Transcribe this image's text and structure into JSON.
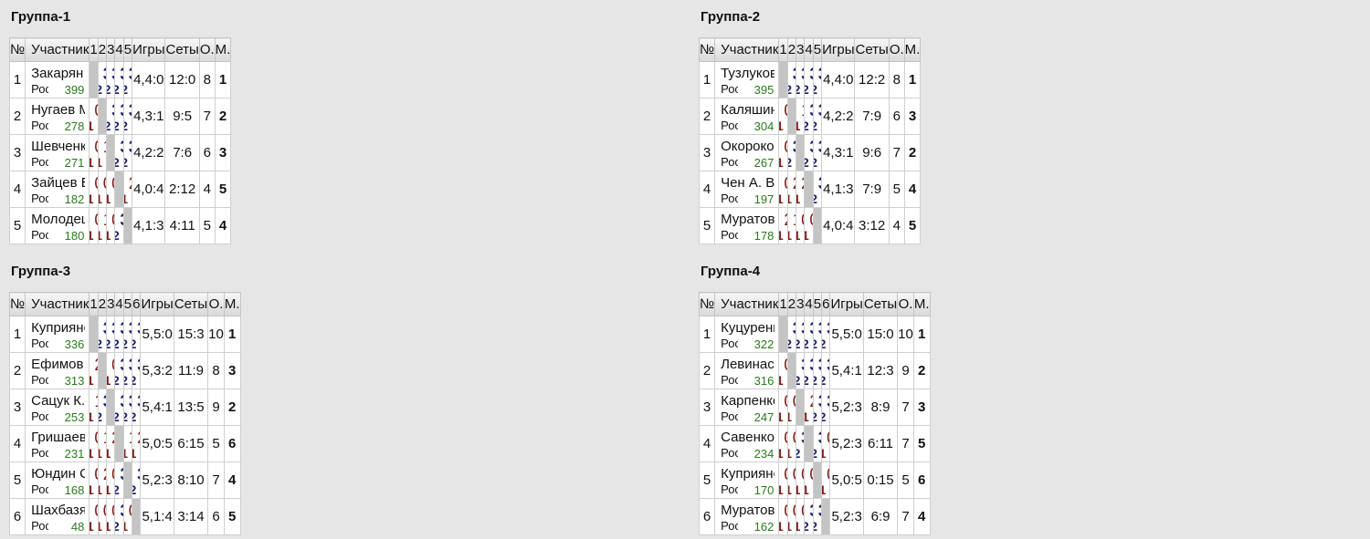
{
  "groups": [
    {
      "title": "Группа-1",
      "headers": {
        "num": "№",
        "name": "Участник",
        "games": "Игры",
        "sets": "Сеты",
        "points": "О.",
        "place": "М.",
        "cols": [
          "1",
          "2",
          "3",
          "4",
          "5"
        ]
      },
      "rows": [
        {
          "num": "1",
          "name": "Закарян Н. А.",
          "region": "Ростовская обл., Рост…",
          "rating": "399",
          "cells": [
            null,
            {
              "s": "3:0",
              "p": "2",
              "w": true
            },
            {
              "s": "3:0",
              "p": "2",
              "w": true
            },
            {
              "s": "3:0",
              "p": "2",
              "w": true
            },
            {
              "s": "3:0",
              "p": "2",
              "w": true
            }
          ],
          "games": "4,4:0",
          "sets": "12:0",
          "points": "8",
          "place": "1"
        },
        {
          "num": "2",
          "name": "Нугаев М. И.",
          "region": "Ростовская обл., Рост…",
          "rating": "278",
          "cells": [
            {
              "s": "0:3",
              "p": "1",
              "w": false
            },
            null,
            {
              "s": "3:1",
              "p": "2",
              "w": true
            },
            {
              "s": "3:0",
              "p": "2",
              "w": true
            },
            {
              "s": "3:1",
              "p": "2",
              "w": true
            }
          ],
          "games": "4,3:1",
          "sets": "9:5",
          "points": "7",
          "place": "2"
        },
        {
          "num": "3",
          "name": "Шевченко Е. И.",
          "region": "Ростовская обл., Рост…",
          "rating": "271",
          "cells": [
            {
              "s": "0:3",
              "p": "1",
              "w": false
            },
            {
              "s": "1:3",
              "p": "1",
              "w": false
            },
            null,
            {
              "s": "3:0",
              "p": "2",
              "w": true
            },
            {
              "s": "3:0",
              "p": "2",
              "w": true
            }
          ],
          "games": "4,2:2",
          "sets": "7:6",
          "points": "6",
          "place": "3"
        },
        {
          "num": "4",
          "name": "Зайцев Е. С.",
          "region": "Ростовская обл., Рост…",
          "rating": "182",
          "cells": [
            {
              "s": "0:3",
              "p": "1",
              "w": false
            },
            {
              "s": "0:3",
              "p": "1",
              "w": false
            },
            {
              "s": "0:3",
              "p": "1",
              "w": false
            },
            null,
            {
              "s": "2:3",
              "p": "1",
              "w": false
            }
          ],
          "games": "4,0:4",
          "sets": "2:12",
          "points": "4",
          "place": "5"
        },
        {
          "num": "5",
          "name": "Молодецкий В. С.",
          "region": "Ростовская обл., Рост…",
          "rating": "180",
          "cells": [
            {
              "s": "0:3",
              "p": "1",
              "w": false
            },
            {
              "s": "1:3",
              "p": "1",
              "w": false
            },
            {
              "s": "0:3",
              "p": "1",
              "w": false
            },
            {
              "s": "3:2",
              "p": "2",
              "w": true
            },
            null
          ],
          "games": "4,1:3",
          "sets": "4:11",
          "points": "5",
          "place": "4"
        }
      ]
    },
    {
      "title": "Группа-2",
      "headers": {
        "num": "№",
        "name": "Участник",
        "games": "Игры",
        "sets": "Сеты",
        "points": "О.",
        "place": "М.",
        "cols": [
          "1",
          "2",
          "3",
          "4",
          "5"
        ]
      },
      "rows": [
        {
          "num": "1",
          "name": "Тузлуков А. Е.",
          "region": "Ростовская обл., Рост…",
          "rating": "395",
          "cells": [
            null,
            {
              "s": "3:0",
              "p": "2",
              "w": true
            },
            {
              "s": "3:0",
              "p": "2",
              "w": true
            },
            {
              "s": "3:0",
              "p": "2",
              "w": true
            },
            {
              "s": "3:2",
              "p": "2",
              "w": true
            }
          ],
          "games": "4,4:0",
          "sets": "12:2",
          "points": "8",
          "place": "1"
        },
        {
          "num": "2",
          "name": "Каляшин Д. А.",
          "region": "Ростовская область, …",
          "rating": "304",
          "cells": [
            {
              "s": "0:3",
              "p": "1",
              "w": false
            },
            null,
            {
              "s": "1:3",
              "p": "1",
              "w": false
            },
            {
              "s": "3:2",
              "p": "2",
              "w": true
            },
            {
              "s": "3:1",
              "p": "2",
              "w": true
            }
          ],
          "games": "4,2:2",
          "sets": "7:9",
          "points": "6",
          "place": "3"
        },
        {
          "num": "3",
          "name": "Окороков В. В.",
          "region": "Ростовская область, …",
          "rating": "267",
          "cells": [
            {
              "s": "0:3",
              "p": "1",
              "w": false
            },
            {
              "s": "3:1",
              "p": "2",
              "w": true
            },
            null,
            {
              "s": "3:2",
              "p": "2",
              "w": true
            },
            {
              "s": "3:0",
              "p": "2",
              "w": true
            }
          ],
          "games": "4,3:1",
          "sets": "9:6",
          "points": "7",
          "place": "2"
        },
        {
          "num": "4",
          "name": "Чен А. В.",
          "region": "Ростовская обл., Рост…",
          "rating": "197",
          "cells": [
            {
              "s": "0:3",
              "p": "1",
              "w": false
            },
            {
              "s": "2:3",
              "p": "1",
              "w": false
            },
            {
              "s": "2:3",
              "p": "1",
              "w": false
            },
            null,
            {
              "s": "3:0",
              "p": "2",
              "w": true
            }
          ],
          "games": "4,1:3",
          "sets": "7:9",
          "points": "5",
          "place": "4"
        },
        {
          "num": "5",
          "name": "Муратов-Милехин Л. П.",
          "region": "Ростовская обл., Рост…",
          "rating": "178",
          "cells": [
            {
              "s": "2:3",
              "p": "1",
              "w": false
            },
            {
              "s": "1:3",
              "p": "1",
              "w": false
            },
            {
              "s": "0:3",
              "p": "1",
              "w": false
            },
            {
              "s": "0:3",
              "p": "1",
              "w": false
            },
            null
          ],
          "games": "4,0:4",
          "sets": "3:12",
          "points": "4",
          "place": "5"
        }
      ]
    },
    {
      "title": "Группа-3",
      "headers": {
        "num": "№",
        "name": "Участник",
        "games": "Игры",
        "sets": "Сеты",
        "points": "О.",
        "place": "М.",
        "cols": [
          "1",
          "2",
          "3",
          "4",
          "5",
          "6"
        ]
      },
      "rows": [
        {
          "num": "1",
          "name": "Куприянов М. М.",
          "region": "Ростовская обл., Рост…",
          "rating": "336",
          "cells": [
            null,
            {
              "s": "3:2",
              "p": "2",
              "w": true
            },
            {
              "s": "3:1",
              "p": "2",
              "w": true
            },
            {
              "s": "3:0",
              "p": "2",
              "w": true
            },
            {
              "s": "3:0",
              "p": "2",
              "w": true
            },
            {
              "s": "3:0",
              "p": "2",
              "w": true
            }
          ],
          "games": "5,5:0",
          "sets": "15:3",
          "points": "10",
          "place": "1"
        },
        {
          "num": "2",
          "name": "Ефимов А. Д.",
          "region": "Ростовская область, …",
          "rating": "313",
          "cells": [
            {
              "s": "2:3",
              "p": "1",
              "w": false
            },
            null,
            {
              "s": "0:3",
              "p": "1",
              "w": false
            },
            {
              "s": "3:1",
              "p": "2",
              "w": true
            },
            {
              "s": "3:2",
              "p": "2",
              "w": true
            },
            {
              "s": "3:0",
              "p": "2",
              "w": true
            }
          ],
          "games": "5,3:2",
          "sets": "11:9",
          "points": "8",
          "place": "3"
        },
        {
          "num": "3",
          "name": "Сацук К. С.",
          "region": "Ростовская обл., Рост…",
          "rating": "253",
          "cells": [
            {
              "s": "1:3",
              "p": "1",
              "w": false
            },
            {
              "s": "3:0",
              "p": "2",
              "w": true
            },
            null,
            {
              "s": "3:2",
              "p": "2",
              "w": true
            },
            {
              "s": "3:0",
              "p": "2",
              "w": true
            },
            {
              "s": "3:0",
              "p": "2",
              "w": true
            }
          ],
          "games": "5,4:1",
          "sets": "13:5",
          "points": "9",
          "place": "2"
        },
        {
          "num": "4",
          "name": "Гришаев В. А.",
          "region": "Ростовская обл., Рост…",
          "rating": "231",
          "cells": [
            {
              "s": "0:3",
              "p": "1",
              "w": false
            },
            {
              "s": "1:3",
              "p": "1",
              "w": false
            },
            {
              "s": "2:3",
              "p": "1",
              "w": false
            },
            null,
            {
              "s": "1:3",
              "p": "1",
              "w": false
            },
            {
              "s": "2:3",
              "p": "1",
              "w": false
            }
          ],
          "games": "5,0:5",
          "sets": "6:15",
          "points": "5",
          "place": "6"
        },
        {
          "num": "5",
          "name": "Юндин С. В.",
          "region": "Ростовская обл., Рост…",
          "rating": "168",
          "cells": [
            {
              "s": "0:3",
              "p": "1",
              "w": false
            },
            {
              "s": "2:3",
              "p": "1",
              "w": false
            },
            {
              "s": "0:3",
              "p": "1",
              "w": false
            },
            {
              "s": "3:1",
              "p": "2",
              "w": true
            },
            null,
            {
              "s": "3:0",
              "p": "2",
              "w": true
            }
          ],
          "games": "5,2:3",
          "sets": "8:10",
          "points": "7",
          "place": "4"
        },
        {
          "num": "6",
          "name": "Шахбазян А. Г.",
          "region": "Ростовская обл., Рост…",
          "rating": "48",
          "cells": [
            {
              "s": "0:3",
              "p": "1",
              "w": false
            },
            {
              "s": "0:3",
              "p": "1",
              "w": false
            },
            {
              "s": "0:3",
              "p": "1",
              "w": false
            },
            {
              "s": "3:2",
              "p": "2",
              "w": true
            },
            {
              "s": "0:3",
              "p": "1",
              "w": false
            },
            null
          ],
          "games": "5,1:4",
          "sets": "3:14",
          "points": "6",
          "place": "5"
        }
      ]
    },
    {
      "title": "Группа-4",
      "headers": {
        "num": "№",
        "name": "Участник",
        "games": "Игры",
        "sets": "Сеты",
        "points": "О.",
        "place": "М.",
        "cols": [
          "1",
          "2",
          "3",
          "4",
          "5",
          "6"
        ]
      },
      "rows": [
        {
          "num": "1",
          "name": "Куцуренко М. А.",
          "region": "Ростовская обл., Рост…",
          "rating": "322",
          "cells": [
            null,
            {
              "s": "3:0",
              "p": "2",
              "w": true
            },
            {
              "s": "3:0",
              "p": "2",
              "w": true
            },
            {
              "s": "3:0",
              "p": "2",
              "w": true
            },
            {
              "s": "3:0",
              "p": "2",
              "w": true
            },
            {
              "s": "3:0",
              "p": "2",
              "w": true
            }
          ],
          "games": "5,5:0",
          "sets": "15:0",
          "points": "10",
          "place": "1"
        },
        {
          "num": "2",
          "name": "Левинас А. В.",
          "region": "Ростовская обл., Тага…",
          "rating": "316",
          "cells": [
            {
              "s": "0:3",
              "p": "1",
              "w": false
            },
            null,
            {
              "s": "3:0",
              "p": "2",
              "w": true
            },
            {
              "s": "3:0",
              "p": "2",
              "w": true
            },
            {
              "s": "3:0",
              "p": "2",
              "w": true
            },
            {
              "s": "3:0",
              "p": "2",
              "w": true
            }
          ],
          "games": "5,4:1",
          "sets": "12:3",
          "points": "9",
          "place": "2"
        },
        {
          "num": "3",
          "name": "Карпенко М. В.",
          "region": "Ростовская область, …",
          "rating": "247",
          "cells": [
            {
              "s": "0:3",
              "p": "1",
              "w": false
            },
            {
              "s": "0:3",
              "p": "1",
              "w": false
            },
            null,
            {
              "s": "2:3",
              "p": "1",
              "w": false
            },
            {
              "s": "3:0",
              "p": "2",
              "w": true
            },
            {
              "s": "3:0",
              "p": "2",
              "w": true
            }
          ],
          "games": "5,2:3",
          "sets": "8:9",
          "points": "7",
          "place": "3"
        },
        {
          "num": "4",
          "name": "Савенко В. С.",
          "region": "Ростовская обл., Рост…",
          "rating": "234",
          "cells": [
            {
              "s": "0:3",
              "p": "1",
              "w": false
            },
            {
              "s": "0:3",
              "p": "1",
              "w": false
            },
            {
              "s": "3:2",
              "p": "2",
              "w": true
            },
            null,
            {
              "s": "3:0",
              "p": "2",
              "w": true
            },
            {
              "s": "0:3",
              "p": "1",
              "w": false
            }
          ],
          "games": "5,2:3",
          "sets": "6:11",
          "points": "7",
          "place": "5"
        },
        {
          "num": "5",
          "name": "Куприянов М. Ю.",
          "region": "Ростовская обл., Рост…",
          "rating": "170",
          "cells": [
            {
              "s": "0:3",
              "p": "1",
              "w": false
            },
            {
              "s": "0:3",
              "p": "1",
              "w": false
            },
            {
              "s": "0:3",
              "p": "1",
              "w": false
            },
            {
              "s": "0:3",
              "p": "1",
              "w": false
            },
            null,
            {
              "s": "0:3",
              "p": "1",
              "w": false
            }
          ],
          "games": "5,0:5",
          "sets": "0:15",
          "points": "5",
          "place": "6"
        },
        {
          "num": "6",
          "name": "Муратова-Милехина М…",
          "region": "Ростовская обл., Рост…",
          "rating": "162",
          "cells": [
            {
              "s": "0:3",
              "p": "1",
              "w": false
            },
            {
              "s": "0:3",
              "p": "1",
              "w": false
            },
            {
              "s": "0:3",
              "p": "1",
              "w": false
            },
            {
              "s": "3:0",
              "p": "2",
              "w": true
            },
            {
              "s": "3:0",
              "p": "2",
              "w": true
            },
            null
          ],
          "games": "5,2:3",
          "sets": "6:9",
          "points": "7",
          "place": "4"
        }
      ]
    }
  ]
}
